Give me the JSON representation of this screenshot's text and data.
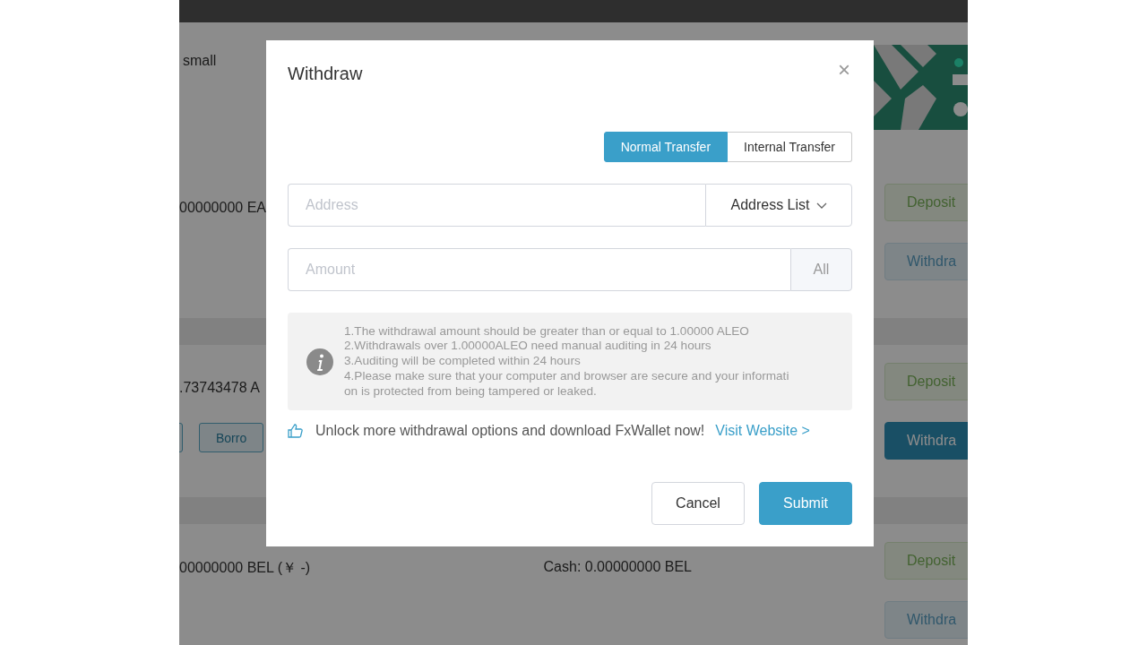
{
  "page": {
    "header_text": "small",
    "rows": [
      {
        "amount": "00000000 EA",
        "cash": null,
        "actions": [],
        "deposit": "Deposit",
        "withdraw": {
          "label": "Withdra",
          "selected": false
        }
      },
      {
        "amount": ".73743478 A",
        "cash": null,
        "actions": [
          {
            "kind": "button"
          },
          {
            "kind": "button",
            "label": "Borro"
          }
        ],
        "deposit": "Deposit",
        "withdraw": {
          "label": "Withdra",
          "selected": true
        }
      },
      {
        "amount": "00000000 BEL (￥ -)",
        "cash": "Cash: 0.00000000 BEL",
        "actions": [],
        "deposit": "Deposit",
        "withdraw": {
          "label": "Withdra",
          "selected": false
        }
      }
    ]
  },
  "dialog": {
    "title": "Withdraw",
    "close": "×",
    "tabs": [
      {
        "label": "Normal Transfer",
        "selected": true
      },
      {
        "label": "Internal Transfer",
        "selected": false
      }
    ],
    "address": {
      "placeholder": "Address",
      "list_button": "Address List"
    },
    "amount": {
      "placeholder": "Amount",
      "all_button": "All"
    },
    "notice_lines": [
      "1.The withdrawal amount should be greater than or equal to 1.00000 ALEO",
      "2.Withdrawals over 1.00000ALEO need manual auditing in 24 hours",
      "3.Auditing will be completed within 24 hours",
      "4.Please make sure that your computer and browser are secure and your informati",
      "on is protected from being tampered or leaked."
    ],
    "promo": {
      "text": "Unlock more withdrawal options and download FxWallet now!",
      "link": "Visit Website >"
    },
    "buttons": [
      {
        "label": "Cancel",
        "kind": "secondary"
      },
      {
        "label": "Submit",
        "kind": "primary"
      }
    ]
  }
}
